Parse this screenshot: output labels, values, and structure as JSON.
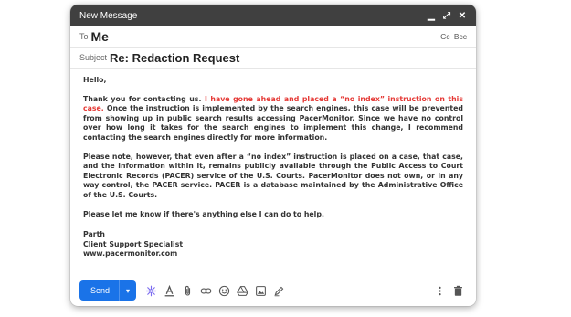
{
  "window": {
    "title": "New Message",
    "minimize_glyph": "▁",
    "expand_glyph": "⤢",
    "close_glyph": "✕"
  },
  "to": {
    "label": "To",
    "value": "Me",
    "cc": "Cc",
    "bcc": "Bcc"
  },
  "subject": {
    "label": "Subject",
    "value": "Re: Redaction Request"
  },
  "body": {
    "greeting": "Hello,",
    "p1_before": "Thank you for contacting us. ",
    "p1_highlight": "I have gone ahead and placed a “no index” instruction on this case.",
    "p1_after": " Once the instruction is implemented by the search engines, this case will be prevented from showing up in public search results accessing PacerMonitor. Since we have no control over how long it takes for the search engines to implement this change, I recommend contacting the search engines directly for more information.",
    "p2": "Please note, however, that even after a “no index” instruction is placed on a case, that case, and the information within it, remains publicly available through the Public Access to Court Electronic Records (PACER) service of the U.S. Courts. PacerMonitor does not own, or in any way control, the PACER service. PACER is a database maintained by the Administrative Office of the U.S. Courts.",
    "p3": "Please let me know if there's anything else I can do to help.",
    "signature": {
      "name": "Parth",
      "role": "Client Support Specialist",
      "site": "www.pacermonitor.com"
    },
    "highlight_color": "#e53935"
  },
  "toolbar": {
    "send_label": "Send",
    "send_more_glyph": "▾",
    "icons": [
      "ai-sparkle-icon",
      "text-format-icon",
      "attach-icon",
      "link-icon",
      "emoji-icon",
      "drive-icon",
      "image-icon",
      "signature-pen-icon",
      "more-options-icon",
      "trash-icon"
    ]
  },
  "colors": {
    "titlebar": "#404040",
    "send": "#1a73e8"
  }
}
